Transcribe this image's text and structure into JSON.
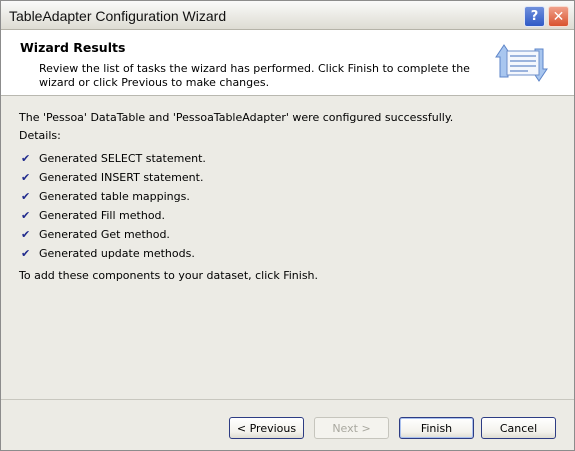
{
  "window": {
    "title": "TableAdapter Configuration Wizard"
  },
  "title_buttons": {
    "help": "?",
    "close": "✕"
  },
  "header": {
    "title": "Wizard Results",
    "description": "Review the list of tasks the wizard has performed. Click Finish to complete the wizard or click Previous to make changes.",
    "icon": "wizard-results-icon"
  },
  "results": {
    "summary": "The 'Pessoa' DataTable and 'PessoaTableAdapter' were configured successfully.",
    "details_label": "Details:",
    "tasks": [
      "Generated SELECT statement.",
      "Generated INSERT statement.",
      "Generated table mappings.",
      "Generated Fill method.",
      "Generated Get method.",
      "Generated update methods."
    ],
    "finish_hint": "To add these components to your dataset, click Finish."
  },
  "buttons": {
    "previous": "< Previous",
    "next": "Next >",
    "finish": "Finish",
    "cancel": "Cancel"
  },
  "colors": {
    "dialog_background": "#ecebe5",
    "check_color": "#1f2a8c",
    "button_border": "#2d3c83"
  }
}
